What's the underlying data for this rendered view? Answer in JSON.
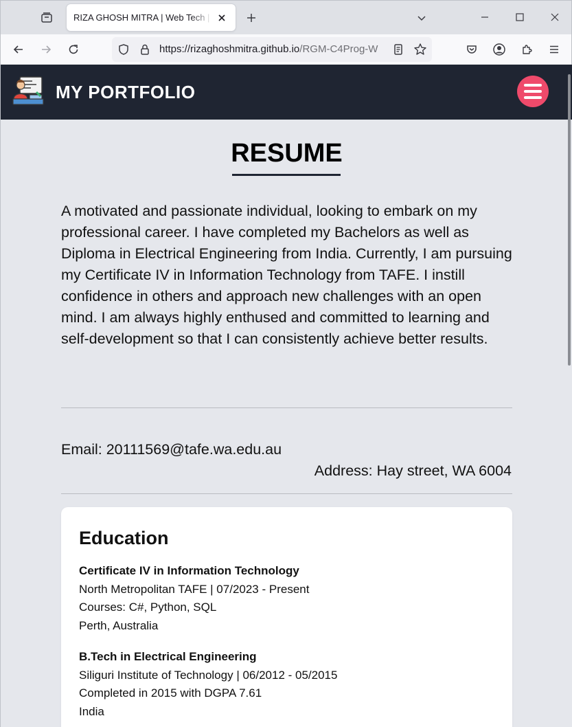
{
  "browser": {
    "tab_title": "RIZA GHOSH MITRA | Web Tech | Cert IV",
    "url_host": "https://rizaghoshmitra.github.io",
    "url_path": "/RGM-C4Prog-W"
  },
  "header": {
    "site_title": "MY PORTFOLIO",
    "menu_color": "#ef4a6b",
    "bg_color": "#1f2532"
  },
  "resume": {
    "heading": "RESUME",
    "intro": "A motivated and passionate individual, looking to embark on my professional career. I have completed my Bachelors as well as Diploma in Electrical Engineering from India. Currently, I am pursuing my Certificate IV in Information Technology from TAFE. I instill confidence in others and approach new challenges with an open mind. I am always highly enthused and committed to learning and self-development so that I can consistently achieve better results.",
    "email": "Email: 20111569@tafe.wa.edu.au",
    "address": "Address: Hay street, WA 6004"
  },
  "education": {
    "title": "Education",
    "entries": [
      {
        "degree": "Certificate IV in Information Technology",
        "institution": "North Metropolitan TAFE | 07/2023 - Present",
        "detail": "Courses: C#, Python, SQL",
        "location": "Perth, Australia"
      },
      {
        "degree": "B.Tech in Electrical Engineering",
        "institution": "Siliguri Institute of Technology | 06/2012 - 05/2015",
        "detail": "Completed in 2015 with DGPA 7.61",
        "location": "India"
      }
    ]
  }
}
